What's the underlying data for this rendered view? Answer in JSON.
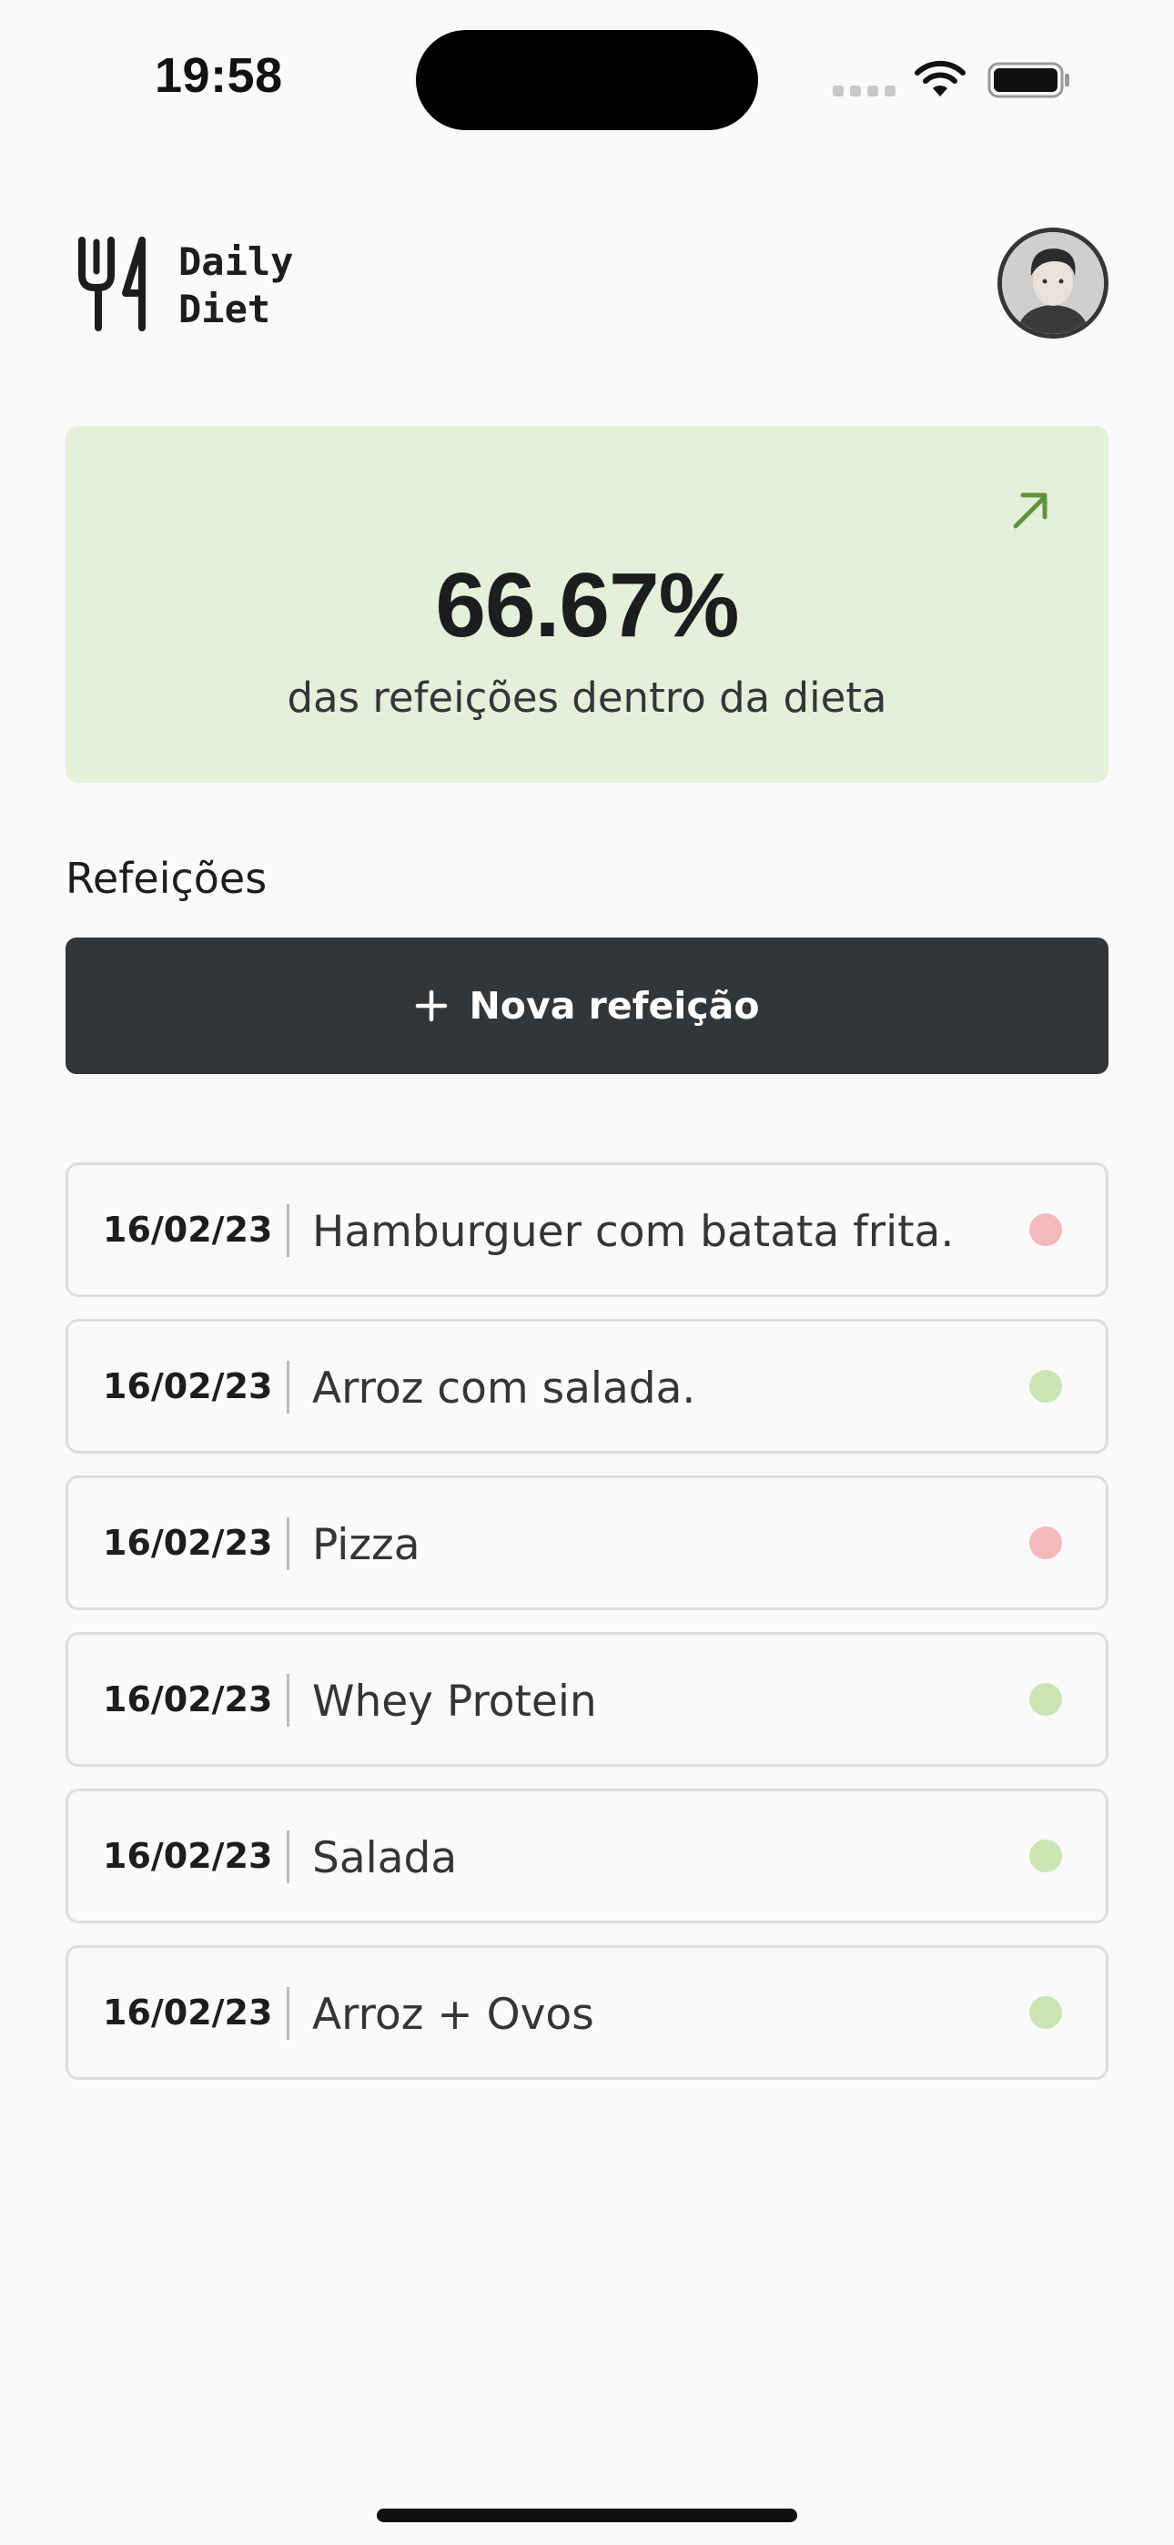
{
  "status_bar": {
    "time": "19:58"
  },
  "header": {
    "logo_line1": "Daily",
    "logo_line2": "Diet"
  },
  "summary": {
    "percent": "66.67%",
    "caption": "das refeições dentro da dieta"
  },
  "meals_section": {
    "title": "Refeições",
    "new_button_label": "Nova refeição"
  },
  "meals": [
    {
      "date": "16/02/23",
      "name": "Hamburguer com batata frita.",
      "in_diet": false
    },
    {
      "date": "16/02/23",
      "name": "Arroz com salada.",
      "in_diet": true
    },
    {
      "date": "16/02/23",
      "name": "Pizza",
      "in_diet": false
    },
    {
      "date": "16/02/23",
      "name": "Whey Protein",
      "in_diet": true
    },
    {
      "date": "16/02/23",
      "name": "Salada",
      "in_diet": true
    },
    {
      "date": "16/02/23",
      "name": "Arroz + Ovos",
      "in_diet": true
    }
  ],
  "colors": {
    "card_green": "#E5F0DB",
    "arrow_green": "#639339",
    "dot_green": "#CBE4B4",
    "dot_red": "#F3BABD",
    "button_dark": "#333638"
  },
  "icons": {
    "logo": "fork-knife-logo-icon",
    "arrow": "arrow-up-right-icon",
    "plus": "plus-icon",
    "wifi": "wifi-icon",
    "battery": "battery-icon"
  }
}
